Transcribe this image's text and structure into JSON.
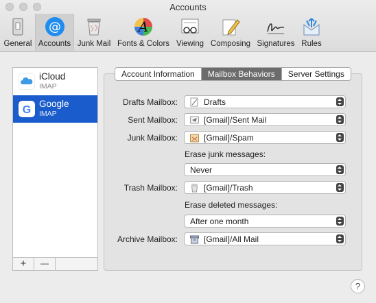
{
  "window": {
    "title": "Accounts"
  },
  "toolbar": {
    "items": [
      {
        "label": "General",
        "icon": "general-icon"
      },
      {
        "label": "Accounts",
        "icon": "at-sign-icon"
      },
      {
        "label": "Junk Mail",
        "icon": "trash-bin-icon"
      },
      {
        "label": "Fonts & Colors",
        "icon": "fonts-colors-icon"
      },
      {
        "label": "Viewing",
        "icon": "viewing-icon"
      },
      {
        "label": "Composing",
        "icon": "pencil-icon"
      },
      {
        "label": "Signatures",
        "icon": "signature-icon"
      },
      {
        "label": "Rules",
        "icon": "rules-icon"
      }
    ],
    "selected": "Accounts"
  },
  "accounts": [
    {
      "name": "iCloud",
      "type": "IMAP",
      "icon": "icloud-icon"
    },
    {
      "name": "Google",
      "type": "IMAP",
      "icon": "google-icon"
    }
  ],
  "list_controls": {
    "add": "+",
    "remove": "—"
  },
  "tabs": [
    {
      "label": "Account Information"
    },
    {
      "label": "Mailbox Behaviors"
    },
    {
      "label": "Server Settings"
    }
  ],
  "active_tab": "Mailbox Behaviors",
  "fields": {
    "drafts": {
      "label": "Drafts Mailbox:",
      "value": "Drafts"
    },
    "sent": {
      "label": "Sent Mailbox:",
      "value": "[Gmail]/Sent Mail"
    },
    "junk": {
      "label": "Junk Mailbox:",
      "value": "[Gmail]/Spam"
    },
    "erase_junk": {
      "label": "Erase junk messages:",
      "value": "Never"
    },
    "trash": {
      "label": "Trash Mailbox:",
      "value": "[Gmail]/Trash"
    },
    "erase_deleted": {
      "label": "Erase deleted messages:",
      "value": "After one month"
    },
    "archive": {
      "label": "Archive Mailbox:",
      "value": "[Gmail]/All Mail"
    }
  },
  "help": {
    "label": "?"
  },
  "colors": {
    "selection": "#1b5ccc",
    "active_tab": "#6c6c6c",
    "accounts_icon": "#1f8cf0"
  }
}
